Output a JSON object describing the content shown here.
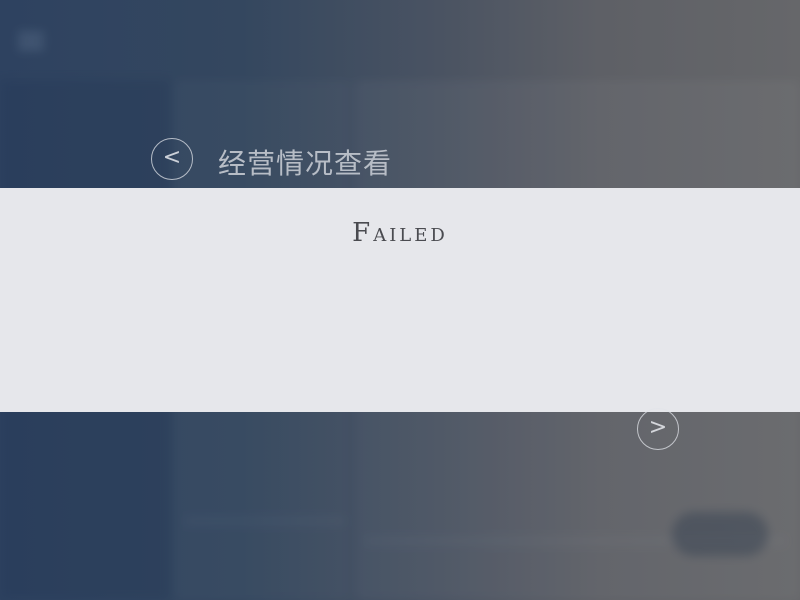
{
  "header": {
    "logo_text": "",
    "menu_icon": "hamburger-icon"
  },
  "navigation": {
    "page_title": "经营情况查看",
    "prev_label": "<",
    "prev_icon": "chevron-left-icon",
    "next_label": ">",
    "next_icon": "chevron-right-icon"
  },
  "status": {
    "message": "Failed"
  },
  "colors": {
    "background_left": "#2e4260",
    "background_right": "#66676a",
    "banner": "#e6e7eb",
    "status_text": "#4a4b50"
  }
}
